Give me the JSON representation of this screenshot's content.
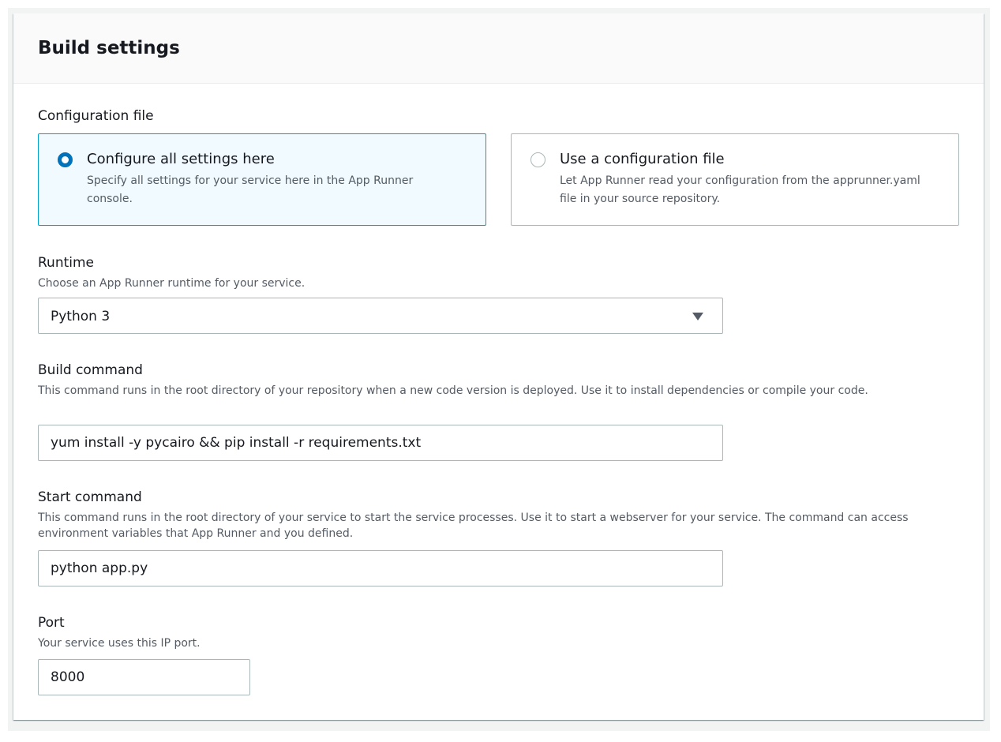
{
  "panel": {
    "title": "Build settings"
  },
  "configuration_file": {
    "label": "Configuration file",
    "options": [
      {
        "title": "Configure all settings here",
        "description": "Specify all settings for your service here in the App Runner console.",
        "selected": true
      },
      {
        "title": "Use a configuration file",
        "description": "Let App Runner read your configuration from the apprunner.yaml file in your source repository.",
        "selected": false
      }
    ]
  },
  "runtime": {
    "label": "Runtime",
    "description": "Choose an App Runner runtime for your service.",
    "value": "Python 3",
    "icon": "caret-down-icon"
  },
  "build_command": {
    "label": "Build command",
    "description": "This command runs in the root directory of your repository when a new code version is deployed. Use it to install dependencies or compile your code.",
    "value": "yum install -y pycairo && pip install -r requirements.txt"
  },
  "start_command": {
    "label": "Start command",
    "description": "This command runs in the root directory of your service to start the service processes. Use it to start a webserver for your service. The command can access environment variables that App Runner and you defined.",
    "value": "python app.py"
  },
  "port": {
    "label": "Port",
    "description": "Your service uses this IP port.",
    "value": "8000"
  },
  "colors": {
    "accent": "#0073bb",
    "selected_border": "#00a1c9",
    "selected_background": "#f1faff",
    "border": "#aab7b8",
    "text": "#16191f",
    "secondary_text": "#545b64"
  }
}
